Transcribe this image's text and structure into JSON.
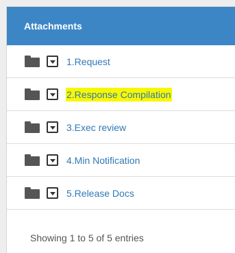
{
  "panel": {
    "title": "Attachments"
  },
  "attachments": [
    {
      "label": "1.Request",
      "highlighted": false
    },
    {
      "label": "2.Response Compilation",
      "highlighted": true
    },
    {
      "label": "3.Exec review",
      "highlighted": false
    },
    {
      "label": "4.Min Notification",
      "highlighted": false
    },
    {
      "label": "5.Release Docs",
      "highlighted": false
    }
  ],
  "footer": {
    "info": "Showing 1 to 5 of 5 entries"
  },
  "colors": {
    "header_bg": "#3d86c6",
    "link": "#2f78b7",
    "highlight": "#f7f700",
    "icon": "#555555"
  }
}
